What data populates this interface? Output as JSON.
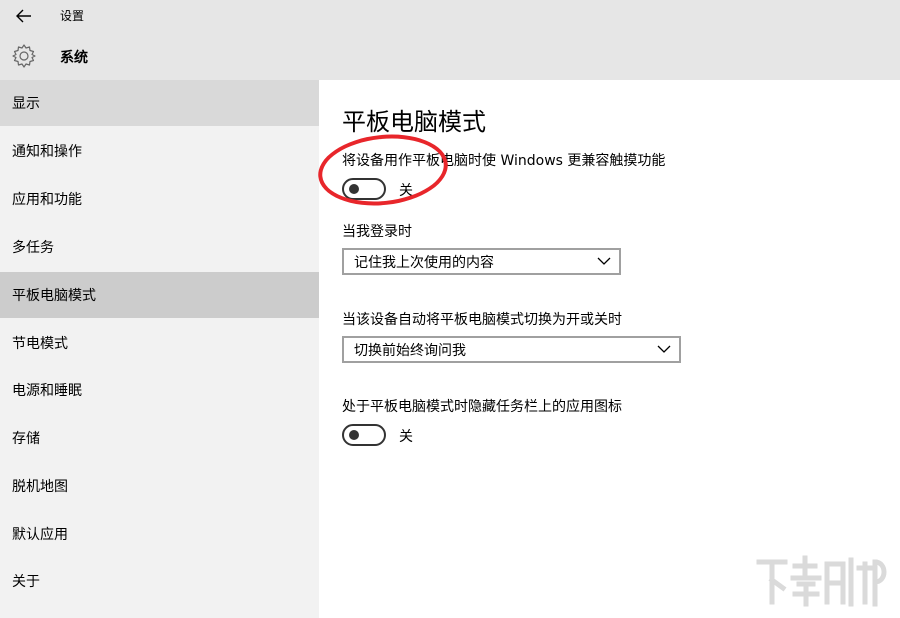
{
  "header": {
    "app_title": "设置",
    "section_title": "系统"
  },
  "sidebar": {
    "items": [
      {
        "label": "显示"
      },
      {
        "label": "通知和操作"
      },
      {
        "label": "应用和功能"
      },
      {
        "label": "多任务"
      },
      {
        "label": "平板电脑模式"
      },
      {
        "label": "节电模式"
      },
      {
        "label": "电源和睡眠"
      },
      {
        "label": "存储"
      },
      {
        "label": "脱机地图"
      },
      {
        "label": "默认应用"
      },
      {
        "label": "关于"
      }
    ],
    "active_index": 4
  },
  "main": {
    "title": "平板电脑模式",
    "setting1": {
      "label": "将设备用作平板电脑时使 Windows 更兼容触摸功能",
      "state": "关"
    },
    "signin": {
      "label": "当我登录时",
      "value": "记住我上次使用的内容"
    },
    "auto_switch": {
      "label": "当该设备自动将平板电脑模式切换为开或关时",
      "value": "切换前始终询问我"
    },
    "hide_icons": {
      "label": "处于平板电脑模式时隐藏任务栏上的应用图标",
      "state": "关"
    }
  },
  "colors": {
    "annotation": "#e8262b",
    "sidebar_bg": "#f2f2f2",
    "active_bg": "#cccccc",
    "titlebar_bg": "#e6e6e6"
  }
}
